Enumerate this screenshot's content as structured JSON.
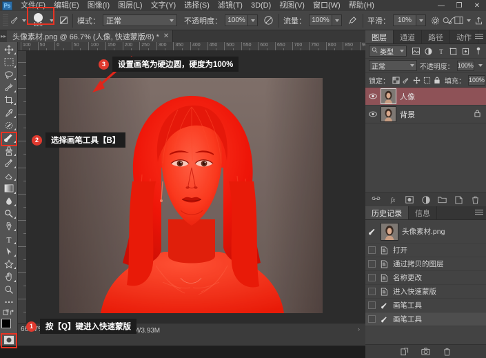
{
  "app": {
    "name": "Photoshop",
    "logo_text": "Ps"
  },
  "menubar": {
    "items": [
      {
        "label": "文件(F)"
      },
      {
        "label": "编辑(E)"
      },
      {
        "label": "图像(I)"
      },
      {
        "label": "图层(L)"
      },
      {
        "label": "文字(Y)"
      },
      {
        "label": "选择(S)"
      },
      {
        "label": "滤镜(T)"
      },
      {
        "label": "3D(D)"
      },
      {
        "label": "视图(V)"
      },
      {
        "label": "窗口(W)"
      },
      {
        "label": "帮助(H)"
      }
    ],
    "window_controls": {
      "minimize": "—",
      "restore": "❐",
      "close": "✕"
    }
  },
  "options_bar": {
    "brush_size": "125",
    "mode_label": "模式：",
    "mode_value": "正常",
    "opacity_label": "不透明度：",
    "opacity_value": "100%",
    "flow_label": "流量：",
    "flow_value": "100%",
    "smoothing_label": "平滑：",
    "smoothing_value": "10%",
    "icons": [
      "brush-tool-icon",
      "brush-preset-icon",
      "brush-panel-icon",
      "airbrush-icon",
      "gear-icon",
      "symmetry-icon",
      "search-icon",
      "workspace-icon",
      "share-icon"
    ]
  },
  "document_tab": {
    "title": "头像素材.png @ 66.7% (人像, 快速蒙版/8) *",
    "close": "✕"
  },
  "rulers": {
    "horizontal_ticks": [
      "100",
      "50",
      "0",
      "50",
      "100",
      "150",
      "200",
      "250",
      "300",
      "350",
      "400",
      "450",
      "500",
      "550",
      "600",
      "650",
      "700",
      "750",
      "800",
      "850",
      "900"
    ],
    "vertical_ticks": [
      "0",
      "50",
      "100",
      "150",
      "200",
      "250",
      "300",
      "350",
      "400",
      "450",
      "500"
    ]
  },
  "toolbar": {
    "tools": [
      {
        "name": "move-tool",
        "glyph": "move"
      },
      {
        "name": "marquee-tool",
        "glyph": "marquee"
      },
      {
        "name": "lasso-tool",
        "glyph": "lasso"
      },
      {
        "name": "quick-selection-tool",
        "glyph": "quickselect"
      },
      {
        "name": "crop-tool",
        "glyph": "crop"
      },
      {
        "name": "eyedropper-tool",
        "glyph": "eyedropper"
      },
      {
        "name": "spot-healing-tool",
        "glyph": "heal"
      },
      {
        "name": "brush-tool",
        "glyph": "brush",
        "active": true
      },
      {
        "name": "clone-stamp-tool",
        "glyph": "stamp"
      },
      {
        "name": "history-brush-tool",
        "glyph": "historybrush"
      },
      {
        "name": "eraser-tool",
        "glyph": "eraser"
      },
      {
        "name": "gradient-tool",
        "glyph": "gradient"
      },
      {
        "name": "blur-tool",
        "glyph": "blur"
      },
      {
        "name": "dodge-tool",
        "glyph": "dodge"
      },
      {
        "name": "pen-tool",
        "glyph": "pen"
      },
      {
        "name": "type-tool",
        "glyph": "T"
      },
      {
        "name": "path-selection-tool",
        "glyph": "pathselect"
      },
      {
        "name": "shape-tool",
        "glyph": "shape"
      },
      {
        "name": "hand-tool",
        "glyph": "hand"
      },
      {
        "name": "zoom-tool",
        "glyph": "zoom"
      },
      {
        "name": "edit-toolbar",
        "glyph": "dots"
      }
    ],
    "foreground_color": "#000000",
    "background_color": "#ffffff",
    "quickmask_name": "quick-mask-toggle"
  },
  "canvas": {
    "overlay_color": "#f41b0e",
    "background_color": "#6d6a66",
    "skin_color": "#d8b49c"
  },
  "status_bar": {
    "zoom": "66.67%",
    "doc_info": "文档:1.70M/3.93M",
    "arrow": "›"
  },
  "layers_panel": {
    "tabs": [
      {
        "label": "图层",
        "active": true
      },
      {
        "label": "通道",
        "active": false
      },
      {
        "label": "路径",
        "active": false
      },
      {
        "label": "动作",
        "active": false
      }
    ],
    "filter_label": "类型",
    "blend_mode": "正常",
    "opacity_label": "不透明度：",
    "opacity_value": "100%",
    "lock_label": "锁定：",
    "fill_label": "填充：",
    "fill_value": "100%",
    "layers": [
      {
        "name": "人像",
        "selected": true,
        "locked": false,
        "visible": true
      },
      {
        "name": "背景",
        "selected": false,
        "locked": true,
        "visible": true
      }
    ],
    "footer_icons": [
      "link-icon",
      "fx-icon",
      "mask-icon",
      "adjustment-icon",
      "group-icon",
      "new-layer-icon",
      "trash-icon"
    ]
  },
  "history_panel": {
    "tabs": [
      {
        "label": "历史记录",
        "active": true
      },
      {
        "label": "信息",
        "active": false
      }
    ],
    "snapshot": "头像素材.png",
    "entries": [
      {
        "label": "打开",
        "icon": "document-icon",
        "current": false
      },
      {
        "label": "通过拷贝的图层",
        "icon": "document-icon",
        "current": false
      },
      {
        "label": "名称更改",
        "icon": "document-icon",
        "current": false
      },
      {
        "label": "进入快速蒙版",
        "icon": "document-icon",
        "current": false
      },
      {
        "label": "画笔工具",
        "icon": "brush-icon",
        "current": false
      },
      {
        "label": "画笔工具",
        "icon": "brush-icon",
        "current": true
      }
    ],
    "footer_icons": [
      "new-document-icon",
      "camera-icon",
      "trash-icon"
    ]
  },
  "annotations": [
    {
      "number": "1",
      "text": "按【Q】键进入快速蒙版"
    },
    {
      "number": "2",
      "text": "选择画笔工具【B】"
    },
    {
      "number": "3",
      "text": "设置画笔为硬边圆，硬度为100%"
    }
  ],
  "highlight_color": "#e83323"
}
